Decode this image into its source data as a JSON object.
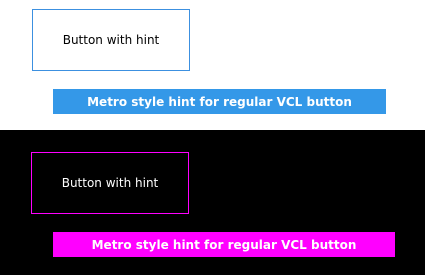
{
  "light_section": {
    "button_label": "Button with hint",
    "hint_text": "Metro style hint for regular VCL button",
    "colors": {
      "background": "#ffffff",
      "button_border": "#3c90e0",
      "hint_background": "#3498e8"
    }
  },
  "dark_section": {
    "button_label": "Button with hint",
    "hint_text": "Metro style hint for regular VCL button",
    "colors": {
      "background": "#000000",
      "button_border": "#ff00ff",
      "hint_background": "#ff00ff"
    }
  }
}
